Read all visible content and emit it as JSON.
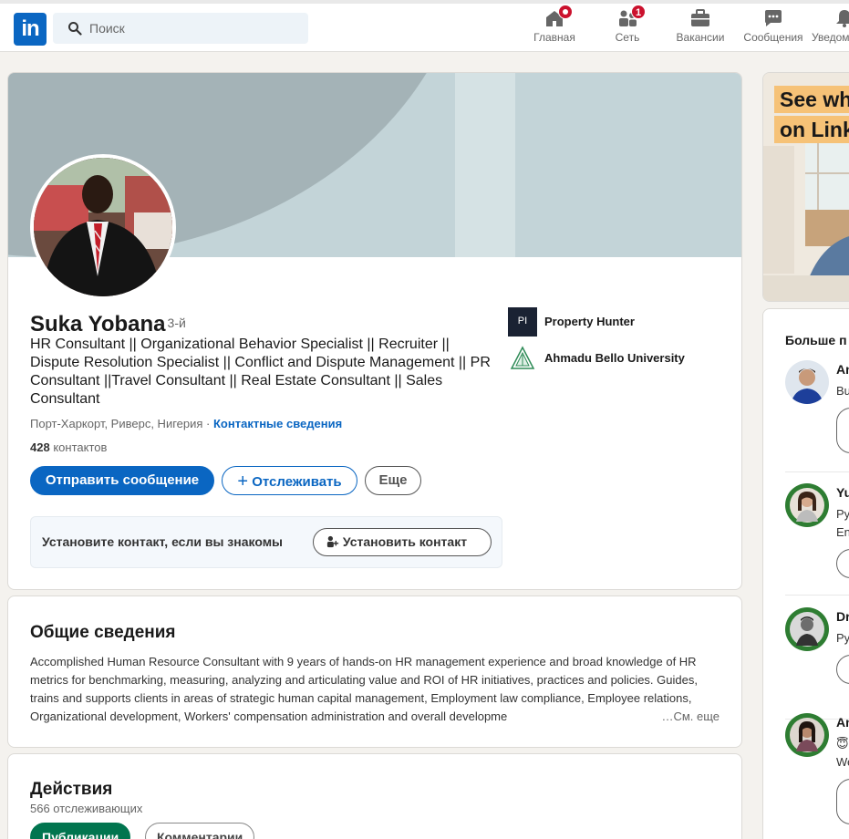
{
  "nav": {
    "logo": "in",
    "search_placeholder": "Поиск",
    "items": [
      {
        "label": "Главная",
        "icon": "home-icon",
        "badge": ""
      },
      {
        "label": "Сеть",
        "icon": "network-icon",
        "badge": "1"
      },
      {
        "label": "Вакансии",
        "icon": "briefcase-icon",
        "badge": ""
      },
      {
        "label": "Сообщения",
        "icon": "messaging-icon",
        "badge": ""
      },
      {
        "label": "Уведом",
        "icon": "bell-icon",
        "badge": ""
      }
    ]
  },
  "profile": {
    "name": "Suka Yobana",
    "degree": "· 3-й",
    "headline": "HR Consultant || Organizational Behavior Specialist || Recruiter || Dispute Resolution Specialist || Conflict and Dispute Management || PR Consultant ||Travel Consultant || Real Estate Consultant || Sales Consultant",
    "location": "Порт-Харкорт, Риверс, Нигерия ·",
    "contact_info": "Контактные сведения",
    "connections_count": "428",
    "connections_label": "контактов",
    "message_button": "Отправить сообщение",
    "follow_button": "Отслеживать",
    "more_button": "Еще",
    "connect_prompt": "Установите контакт, если вы знакомы",
    "connect_button": "Установить контакт",
    "companies": [
      {
        "name": "Property Hunter",
        "logo_text": "PI"
      },
      {
        "name": "Ahmadu Bello University"
      }
    ]
  },
  "about": {
    "title": "Общие сведения",
    "text": "Accomplished Human Resource Consultant with 9 years of hands-on HR management experience and broad knowledge of HR metrics for benchmarking, measuring, analyzing and articulating value and ROI of HR initiatives, practices and policies. Guides, trains and supports clients in areas of strategic human capital management, Employment law compliance, Employee relations, Organizational development, Workers' compensation administration and overall developme",
    "see_more": "…См. еще"
  },
  "activity": {
    "title": "Действия",
    "followers": "566 отслеживающих",
    "tabs": [
      "Публикации",
      "Комментарии"
    ]
  },
  "sidebar": {
    "ad_lines": [
      "See wh",
      "on Link"
    ],
    "people_title": "Больше п",
    "people": [
      {
        "name": "An",
        "desc": [
          "Bu"
        ]
      },
      {
        "name": "Yu",
        "desc": [
          "Ру",
          "En"
        ]
      },
      {
        "name": "Dr",
        "desc": [
          "Ру"
        ]
      },
      {
        "name": "An",
        "desc": [
          "😇",
          "We"
        ]
      }
    ]
  },
  "colors": {
    "primary": "#0a66c2",
    "badge": "#cb112d",
    "active_tab": "#01754f",
    "ad_highlight": "#f6c277"
  }
}
